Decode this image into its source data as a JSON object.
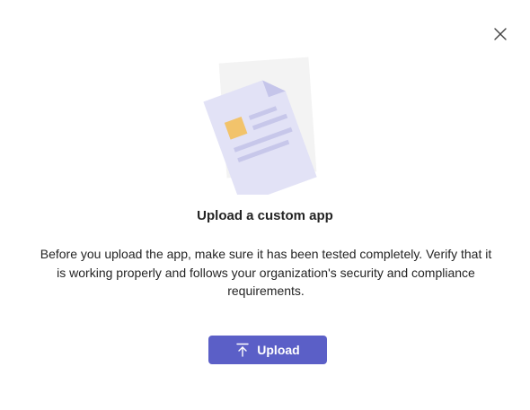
{
  "dialog": {
    "close_icon": "close-icon",
    "illustration_icon": "document-illustration-icon",
    "title": "Upload a custom app",
    "description": "Before you upload the app, make sure it has been tested completely. Verify that it is working properly and follows your organization's security and compliance requirements.",
    "upload_button": {
      "label": "Upload",
      "icon": "upload-arrow-icon"
    }
  },
  "colors": {
    "accent": "#5b5fc7",
    "document_fill": "#e2e2f6",
    "document_fold": "#c5c5ea",
    "document_lines": "#c7c7ea",
    "image_block": "#f2c36b",
    "back_page": "#f2f2f2"
  }
}
